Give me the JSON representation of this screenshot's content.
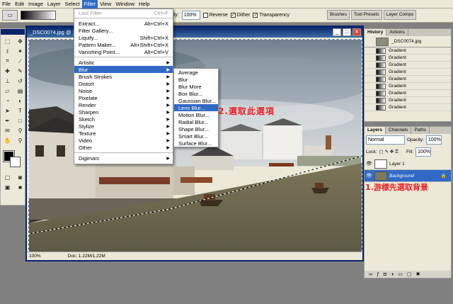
{
  "menubar": [
    "File",
    "Edit",
    "Image",
    "Layer",
    "Select",
    "Filter",
    "View",
    "Window",
    "Help"
  ],
  "options": {
    "opacity_label": "Opacity:",
    "opacity_value": "100%",
    "reverse": "Reverse",
    "dither": "Dither",
    "transparency": "Transparency"
  },
  "palette_tabs": [
    "Brushes",
    "Tool Presets",
    "Layer Comps"
  ],
  "document": {
    "title": "_DSC0074.jpg @ 100% (Background, RGB/8#)",
    "zoom": "100%",
    "doc_size": "Doc: 1.22M/1.22M"
  },
  "filter_menu": {
    "last_filter": "Last Filter",
    "last_filter_sc": "Ctrl+F",
    "items": [
      {
        "label": "Extract...",
        "sc": "Alt+Ctrl+X"
      },
      {
        "label": "Filter Gallery...",
        "sc": ""
      },
      {
        "label": "Liquify...",
        "sc": "Shift+Ctrl+X"
      },
      {
        "label": "Pattern Maker...",
        "sc": "Alt+Shift+Ctrl+X"
      },
      {
        "label": "Vanishing Point...",
        "sc": "Alt+Ctrl+V"
      }
    ],
    "submenus": [
      "Artistic",
      "Blur",
      "Brush Strokes",
      "Distort",
      "Noise",
      "Pixelate",
      "Render",
      "Sharpen",
      "Sketch",
      "Stylize",
      "Texture",
      "Video",
      "Other"
    ],
    "digimarc": "Digimarc"
  },
  "blur_menu": [
    "Average",
    "Blur",
    "Blur More",
    "Box Blur...",
    "Gaussian Blur...",
    "Lens Blur...",
    "Motion Blur...",
    "Radial Blur...",
    "Shape Blur...",
    "Smart Blur...",
    "Surface Blur..."
  ],
  "history": {
    "tabs": [
      "History",
      "Actions"
    ],
    "snapshot": "_DSC0074.jpg",
    "states": [
      "Gradient",
      "Gradient",
      "Gradient",
      "Gradient",
      "Gradient",
      "Gradient",
      "Gradient",
      "Gradient",
      "Gradient"
    ]
  },
  "layers": {
    "tabs": [
      "Layers",
      "Channels",
      "Paths"
    ],
    "blend": "Normal",
    "opacity_label": "Opacity:",
    "opacity": "100%",
    "lock_label": "Lock:",
    "fill_label": "Fill:",
    "fill": "100%",
    "items": [
      "Layer 1",
      "Background"
    ]
  },
  "annotations": {
    "step1": "1.游標先選取背景",
    "step2": "2.選取此選項"
  },
  "colors": {
    "highlight": "#316ac5",
    "title_bar": "#0a246a",
    "annotation": "#e8232a"
  }
}
